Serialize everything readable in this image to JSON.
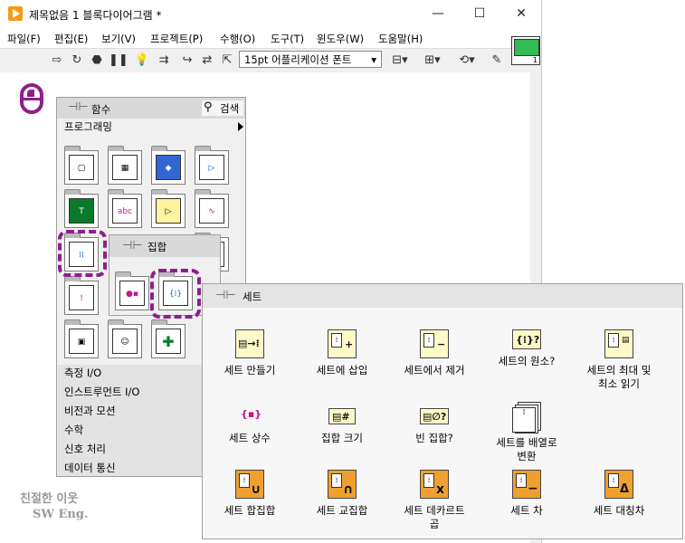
{
  "window": {
    "title": "제목없음 1 블록다이어그램 *",
    "minimize": "—",
    "maximize": "☐",
    "close": "✕"
  },
  "menu": [
    "파일(F)",
    "편집(E)",
    "보기(V)",
    "프로젝트(P)",
    "수행(O)",
    "도구(T)",
    "윈도우(W)",
    "도움말(H)"
  ],
  "toolbar": {
    "font": "15pt 어플리케이션 폰트",
    "vi_number": "1"
  },
  "functions_palette": {
    "title": "함수",
    "search": "검색",
    "subcategory": "프로그래밍",
    "categories": [
      "측정 I/O",
      "인스트루먼트 I/O",
      "비전과 모션",
      "수학",
      "신호 처리",
      "데이터 통신"
    ]
  },
  "set_subpalette": {
    "title": "집합"
  },
  "set_palette": {
    "title": "세트",
    "items": [
      {
        "label": "세트 만들기",
        "icon": "build-set-icon"
      },
      {
        "label": "세트에 삽입",
        "icon": "insert-into-set-icon"
      },
      {
        "label": "세트에서 제거",
        "icon": "remove-from-set-icon"
      },
      {
        "label": "세트의 원소?",
        "icon": "member-of-set-icon"
      },
      {
        "label": "세트의 최대 및\n최소 읽기",
        "icon": "set-max-min-icon"
      },
      {
        "label": "세트 상수",
        "icon": "set-constant-icon"
      },
      {
        "label": "집합 크기",
        "icon": "set-size-icon"
      },
      {
        "label": "빈 집합?",
        "icon": "empty-set-icon"
      },
      {
        "label": "세트를 배열로\n변환",
        "icon": "set-to-array-icon"
      },
      {
        "label": "세트 합집합",
        "icon": "union-icon"
      },
      {
        "label": "세트 교집합",
        "icon": "intersection-icon"
      },
      {
        "label": "세트 데카르트\n곱",
        "icon": "cartesian-product-icon"
      },
      {
        "label": "세트 차",
        "icon": "difference-icon"
      },
      {
        "label": "세트 대칭차",
        "icon": "symmetric-difference-icon"
      }
    ]
  },
  "watermark": {
    "line1": "친절한 이웃",
    "line2": "SW Eng."
  },
  "colors": {
    "highlight": "#8e1e8e",
    "set_orange": "#f0a030",
    "set_yellow": "#fff8c8"
  }
}
